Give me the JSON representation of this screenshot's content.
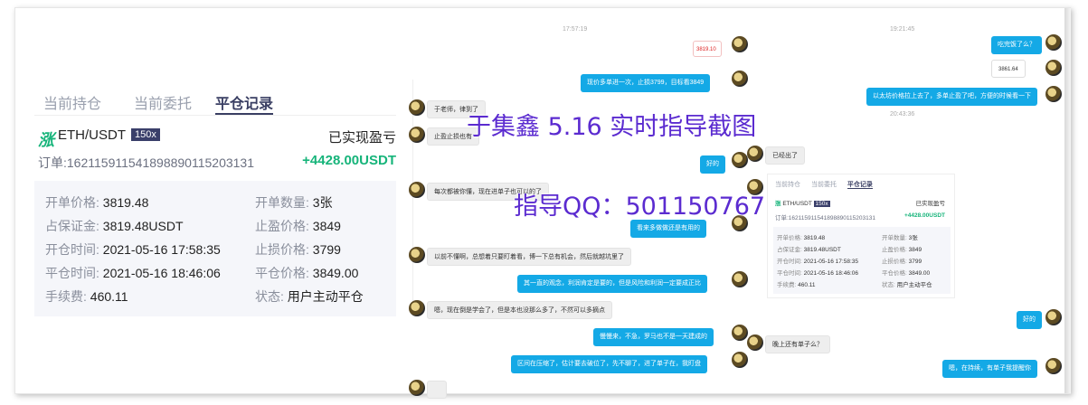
{
  "trade": {
    "tabs": [
      "当前持仓",
      "当前委托",
      "平仓记录"
    ],
    "brand_icon": "涨",
    "pair": "ETH/USDT",
    "leverage": "150x",
    "pnl_label": "已实现盈亏",
    "order": "订单:1621159115418988901152031​31",
    "pnl": "+4428.00USDT",
    "details": [
      {
        "k": "开单价格:",
        "v": "3819.48"
      },
      {
        "k": "开单数量:",
        "v": "3张"
      },
      {
        "k": "占保证金:",
        "v": "3819.48USDT"
      },
      {
        "k": "止盈价格:",
        "v": "3849"
      },
      {
        "k": "开仓时间:",
        "v": "2021-05-16 17:58:35"
      },
      {
        "k": "止损价格:",
        "v": "3799"
      },
      {
        "k": "平仓时间:",
        "v": "2021-05-16 18:46:06"
      },
      {
        "k": "平仓价格:",
        "v": "3849.00"
      },
      {
        "k": "手续费:",
        "v": "460.11"
      },
      {
        "k": "状态:",
        "v": "用户主动平仓"
      }
    ]
  },
  "chat1": {
    "timestamp": "17:57:19",
    "image_label": "3819.10",
    "messages": [
      "现价多单进一次，止损3799，目标看3849",
      "于老师，律到了",
      "止盈止损也有",
      "好的",
      "每次都被你懂，现在进单子也可以的了",
      "看来多做做还是有用的",
      "以前不懂啊，总想着只要盯着看，博一下总有机会，然后就越坑里了",
      "其一直的观念，利润肯定是要的，但是风险和利润一定要成正比",
      "嗯，现在倒是学会了，但是本也没那么多了，不然可以多摘点",
      "慢慢来，不急，罗马也不是一天建成的",
      "区间在压缩了，估计要去破位了，先不聊了，进了单子在，我盯盘"
    ]
  },
  "chat2": {
    "timestamp1": "19:21:45",
    "timestamp2": "20:43:36",
    "price_label": "3861.64",
    "messages": [
      "吃完饭了么？",
      "以太坊价格拉上去了，多单止盈了吧，方便的时候看一下",
      "已经出了",
      "好的",
      "晚上还有单子么？",
      "嗯，在持续，有单子我提醒你"
    ]
  },
  "mini": {
    "tabs": [
      "当前持仓",
      "当前委托",
      "平仓记录"
    ],
    "pair": "ETH/USDT",
    "leverage": "150x",
    "pnl_label": "已实现盈亏",
    "order": "订单:1621159115418988901152031​31",
    "pnl": "+4428.00USDT"
  },
  "watermark": {
    "line1": "于集鑫 5.16 实时指导截图",
    "line2": "指导QQ：501150767"
  }
}
